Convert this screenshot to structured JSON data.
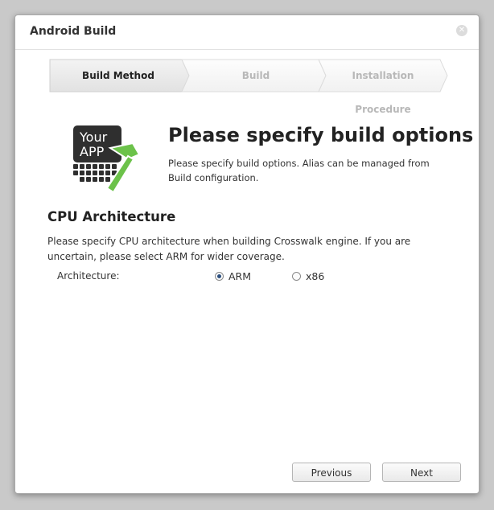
{
  "dialog": {
    "title": "Android Build",
    "close_icon": "close-icon"
  },
  "steps": [
    {
      "label": "Build Method",
      "active": true
    },
    {
      "label": "Build",
      "active": false
    },
    {
      "label": "Installation Procedure",
      "active": false
    }
  ],
  "header": {
    "icon_text_line1": "Your",
    "icon_text_line2": "APP",
    "title": "Please specify build options",
    "description": "Please specify build options. Alias can be managed from Build configuration."
  },
  "cpu": {
    "section_title": "CPU Architecture",
    "description": "Please specify CPU architecture when building Crosswalk engine. If you are uncertain, please select ARM for wider coverage.",
    "architecture_label": "Architecture:",
    "options": [
      {
        "label": "ARM",
        "selected": true
      },
      {
        "label": "x86",
        "selected": false
      }
    ]
  },
  "buttons": {
    "previous": "Previous",
    "next": "Next"
  },
  "colors": {
    "accent_green": "#6cc24a",
    "radio_dot": "#2b4f7e",
    "step_active_bg": "#e9e9e9",
    "step_inactive_text": "#b8b8b8"
  }
}
